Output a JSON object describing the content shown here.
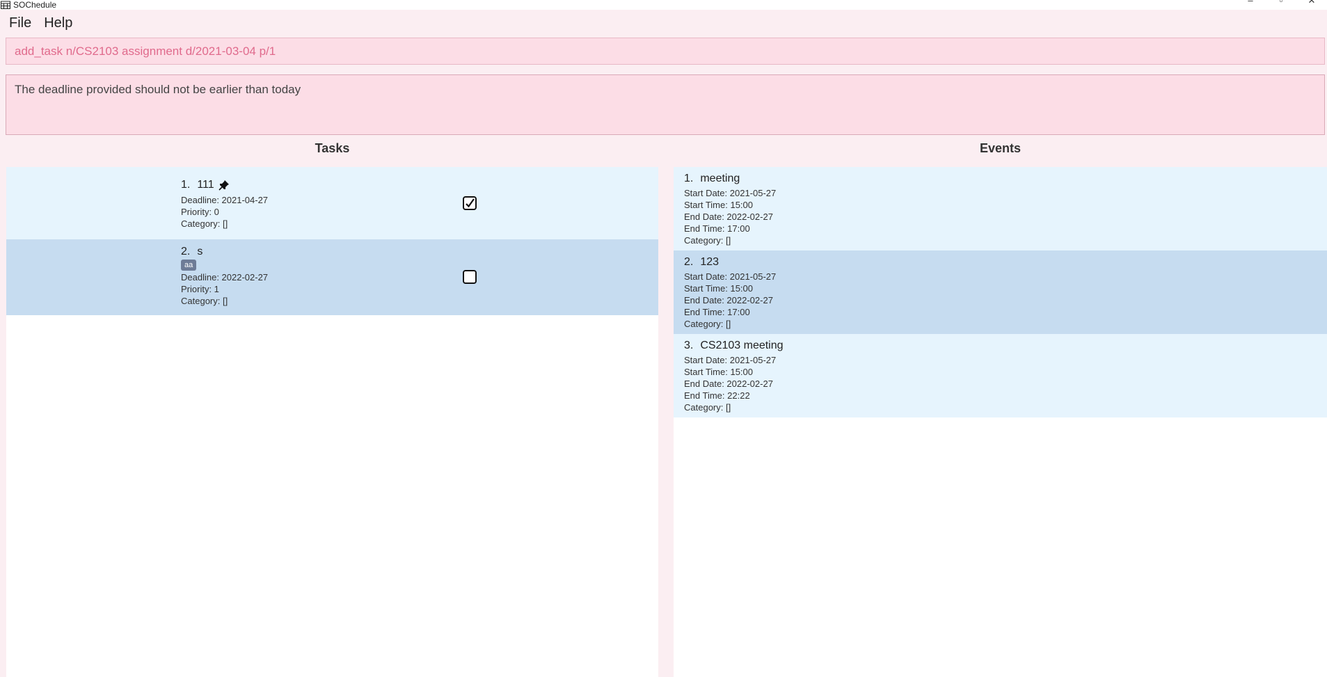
{
  "window": {
    "title": "SOChedule",
    "app_icon": "calendar-icon",
    "controls": [
      "minimize-icon",
      "restore-icon",
      "close-icon"
    ]
  },
  "menu": {
    "file": "File",
    "help": "Help"
  },
  "command": {
    "value": "add_task n/CS2103 assignment d/2021-03-04 p/1"
  },
  "result": {
    "message": "The deadline provided should not be earlier than today"
  },
  "tasks": {
    "title": "Tasks",
    "items": [
      {
        "index": "1.",
        "name": "111",
        "pinned": true,
        "tag": "",
        "deadline": "Deadline: 2021-04-27",
        "priority": "Priority: 0",
        "category": "Category: []",
        "done": true
      },
      {
        "index": "2.",
        "name": "s",
        "pinned": false,
        "tag": "aa",
        "deadline": "Deadline: 2022-02-27",
        "priority": "Priority: 1",
        "category": "Category: []",
        "done": false
      }
    ]
  },
  "events": {
    "title": "Events",
    "items": [
      {
        "index": "1.",
        "name": "meeting",
        "start_date": "Start Date: 2021-05-27",
        "start_time": "Start Time: 15:00",
        "end_date": "End Date: 2022-02-27",
        "end_time": "End Time: 17:00",
        "category": "Category: []"
      },
      {
        "index": "2.",
        "name": "123",
        "start_date": "Start Date: 2021-05-27",
        "start_time": "Start Time: 15:00",
        "end_date": "End Date: 2022-02-27",
        "end_time": "End Time: 17:00",
        "category": "Category: []"
      },
      {
        "index": "3.",
        "name": "CS2103 meeting",
        "start_date": "Start Date: 2021-05-27",
        "start_time": "Start Time: 15:00",
        "end_date": "End Date: 2022-02-27",
        "end_time": "End Time: 22:22",
        "category": "Category: []"
      }
    ]
  },
  "colors": {
    "background": "#fbeef2",
    "input_background": "#fcdde6",
    "command_text": "#e06a8c",
    "card_light": "#e6f4fd",
    "card_dark": "#c6dcf0",
    "tag": "#6e7c97"
  }
}
